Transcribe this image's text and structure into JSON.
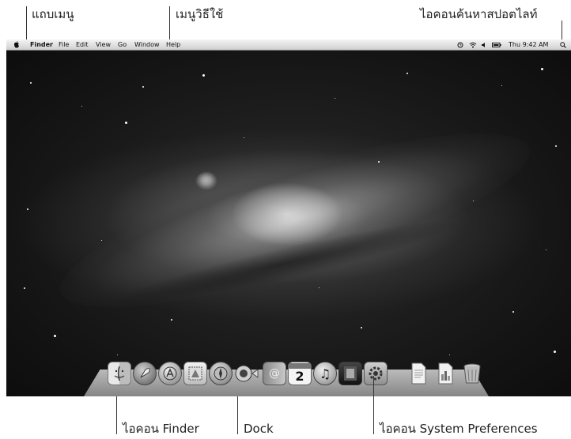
{
  "callouts": {
    "menu_bar": "แถบเมนู",
    "help_menu": "เมนูวิธีใช้",
    "spotlight_icon": "ไอคอนค้นหาสปอตไลท์",
    "finder_icon": "ไอคอน Finder",
    "dock": "Dock",
    "system_preferences_icon": "ไอคอน System Preferences"
  },
  "menubar": {
    "app_name": "Finder",
    "items": [
      "File",
      "Edit",
      "View",
      "Go",
      "Window",
      "Help"
    ],
    "clock": "Thu 9:42 AM"
  },
  "dock": {
    "calendar_day": "2",
    "icons": [
      "finder-icon",
      "launchpad-icon",
      "app-store-icon",
      "mail-icon",
      "safari-icon",
      "facetime-icon",
      "contacts-icon",
      "calendar-icon",
      "itunes-icon",
      "photo-booth-icon",
      "system-preferences-icon",
      "document-icon",
      "document-icon",
      "trash-icon"
    ]
  }
}
